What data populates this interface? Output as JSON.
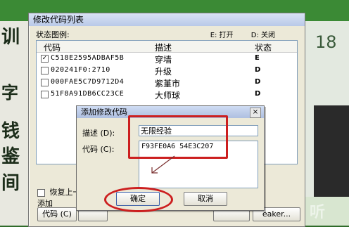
{
  "main_dialog": {
    "title": "修改代码列表",
    "status_legend": "状态图例:",
    "legend_e": "E: 打开",
    "legend_d": "D: 关闭",
    "columns": [
      "代码",
      "描述",
      "状态"
    ],
    "rows": [
      {
        "checked": true,
        "code": "C518E2595ADBAF5B",
        "desc": "穿墙",
        "status": "E"
      },
      {
        "checked": false,
        "code": "020241F0:2710",
        "desc": "升级",
        "status": "D"
      },
      {
        "checked": false,
        "code": "000FAE5C7D9712D4",
        "desc": "紫堇市",
        "status": "D"
      },
      {
        "checked": false,
        "code": "51F8A91DB6CC23CE",
        "desc": "大师球",
        "status": "D"
      }
    ],
    "restore_label": "恢复上一",
    "add_label": "添加",
    "code_button": "代码 (C)",
    "maker_button": "eaker..."
  },
  "popup": {
    "title": "添加修改代码",
    "close_glyph": "×",
    "desc_label": "描述 (D):",
    "desc_value": "无限经验",
    "code_label": "代码 (C):",
    "code_value": "F93FE0A6 54E3C207",
    "ok_label": "确定",
    "cancel_label": "取消"
  },
  "background": {
    "glyph_1": "训",
    "glyph_2": "字",
    "glyph_3": "钱",
    "glyph_4": "鉴",
    "glyph_5": "间",
    "number": "18"
  },
  "watermark": "听"
}
